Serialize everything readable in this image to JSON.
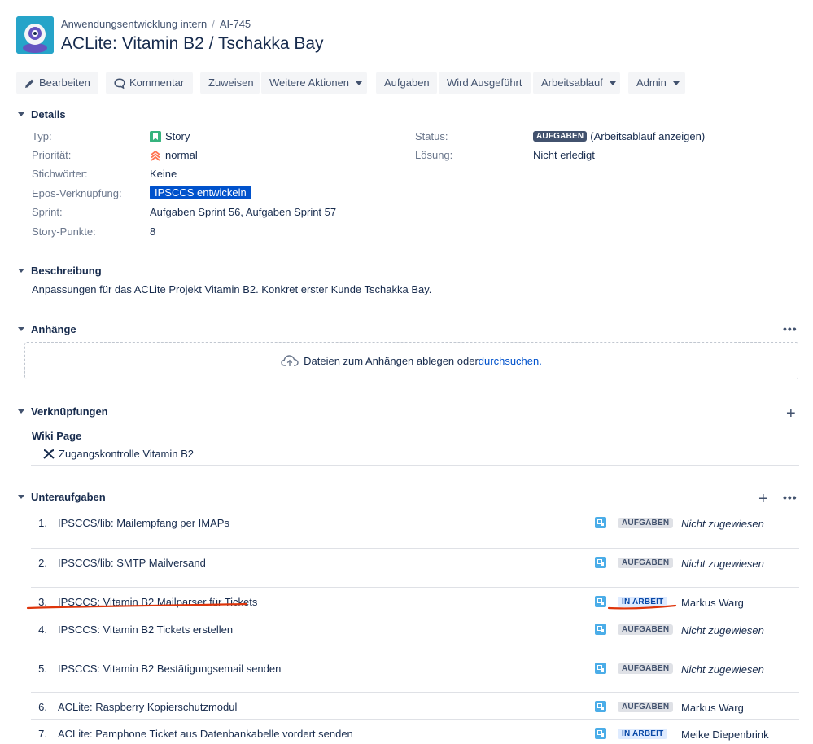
{
  "breadcrumb": {
    "project": "Anwendungsentwicklung intern",
    "separator": "/",
    "issue_key": "AI-745"
  },
  "issue": {
    "title": "ACLite: Vitamin B2 / Tschakka Bay"
  },
  "toolbar": {
    "edit": "Bearbeiten",
    "comment": "Kommentar",
    "assign": "Zuweisen",
    "more": "Weitere Aktionen",
    "tasks": "Aufgaben",
    "in_progress": "Wird Ausgeführt",
    "workflow": "Arbeitsablauf",
    "admin": "Admin"
  },
  "details": {
    "heading": "Details",
    "type_label": "Typ:",
    "type_value": "Story",
    "priority_label": "Priorität:",
    "priority_value": "normal",
    "labels_label": "Stichwörter:",
    "labels_value": "Keine",
    "epic_label": "Epos-Verknüpfung:",
    "epic_value": "IPSCCS entwickeln",
    "sprint_label": "Sprint:",
    "sprint_value": "Aufgaben Sprint 56, Aufgaben Sprint 57",
    "points_label": "Story-Punkte:",
    "points_value": "8",
    "status_label": "Status:",
    "status_value": "AUFGABEN",
    "status_link": "(Arbeitsablauf anzeigen)",
    "resolution_label": "Lösung:",
    "resolution_value": "Nicht erledigt"
  },
  "description": {
    "heading": "Beschreibung",
    "text": "Anpassungen für das ACLite Projekt Vitamin B2. Konkret erster Kunde Tschakka Bay."
  },
  "attachments": {
    "heading": "Anhänge",
    "drop_text": "Dateien zum Anhängen ablegen oder ",
    "browse_link": "durchsuchen."
  },
  "links": {
    "heading": "Verknüpfungen",
    "group": "Wiki Page",
    "item": "Zugangskontrolle Vitamin B2"
  },
  "subtasks": {
    "heading": "Unteraufgaben",
    "items": [
      {
        "num": "1.",
        "summary": "IPSCCS/lib: Mailempfang per IMAPs",
        "status": "AUFGABEN",
        "assignee": "Nicht zugewiesen"
      },
      {
        "num": "2.",
        "summary": "IPSCCS/lib: SMTP Mailversand",
        "status": "AUFGABEN",
        "assignee": "Nicht zugewiesen"
      },
      {
        "num": "3.",
        "summary": "IPSCCS: Vitamin B2 Mailparser für Tickets",
        "status": "IN ARBEIT",
        "assignee": "Markus Warg"
      },
      {
        "num": "4.",
        "summary": "IPSCCS: Vitamin B2 Tickets erstellen",
        "status": "AUFGABEN",
        "assignee": "Nicht zugewiesen"
      },
      {
        "num": "5.",
        "summary": "IPSCCS: Vitamin B2 Bestätigungsemail senden",
        "status": "AUFGABEN",
        "assignee": "Nicht zugewiesen"
      },
      {
        "num": "6.",
        "summary": "ACLite: Raspberry Kopierschutzmodul",
        "status": "AUFGABEN",
        "assignee": "Markus Warg"
      },
      {
        "num": "7.",
        "summary": "ACLite: Pamphone Ticket aus Datenbankabelle vordert senden",
        "status": "IN ARBEIT",
        "assignee": "Meike Diepenbrink"
      }
    ]
  },
  "colors": {
    "accent": "#0052cc",
    "avatar": "#26a4c9",
    "story": "#36b37e",
    "priority": "#ff7452",
    "annotation": "#de350b"
  }
}
